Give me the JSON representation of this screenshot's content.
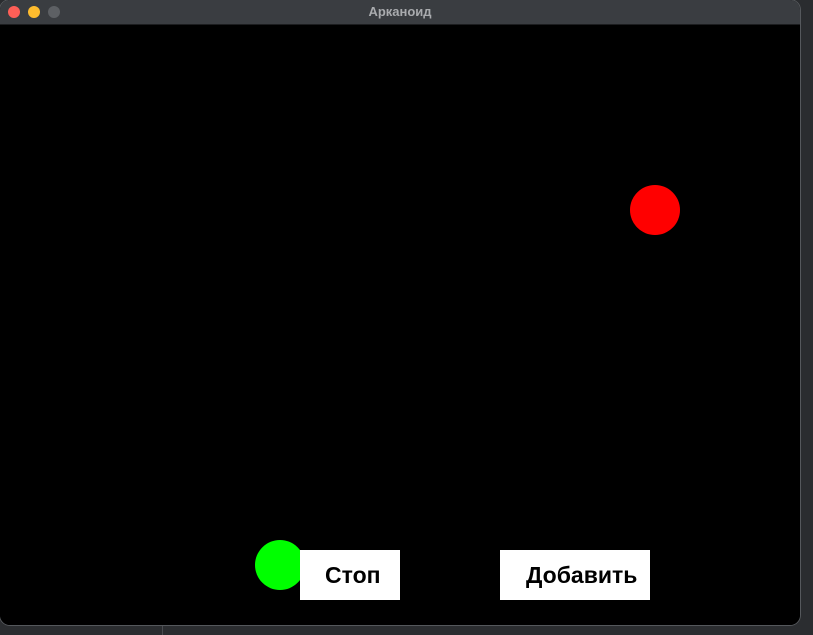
{
  "window": {
    "title": "Арканоид"
  },
  "game": {
    "balls": [
      {
        "name": "red-ball",
        "color": "#ff0000"
      },
      {
        "name": "green-ball",
        "color": "#00ff00"
      }
    ],
    "buttons": {
      "stop_label": "Стоп",
      "add_label": "Добавить"
    }
  }
}
